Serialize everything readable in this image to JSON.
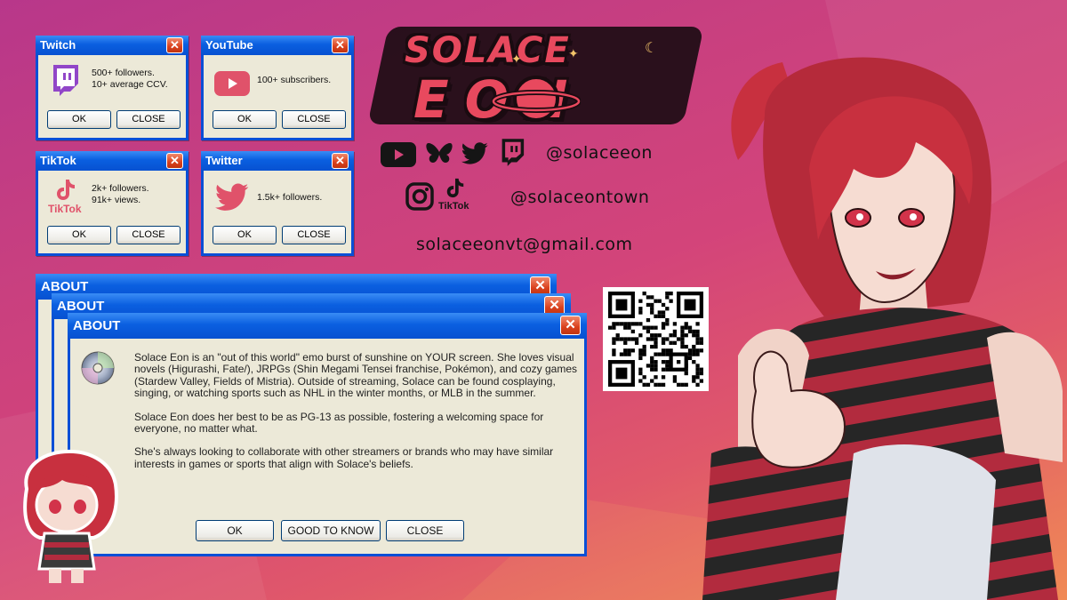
{
  "logo": {
    "line1": "SOLACE",
    "line2": "EON"
  },
  "mini_windows": [
    {
      "title": "Twitch",
      "text": "500+ followers.\n10+ average CCV.",
      "ok": "OK",
      "close": "CLOSE",
      "icon": "twitch-icon"
    },
    {
      "title": "YouTube",
      "text": "100+ subscribers.",
      "ok": "OK",
      "close": "CLOSE",
      "icon": "youtube-icon"
    },
    {
      "title": "TikTok",
      "text": "2k+ followers.\n91k+ views.",
      "ok": "OK",
      "close": "CLOSE",
      "icon": "tiktok-icon",
      "icon_label": "TikTok"
    },
    {
      "title": "Twitter",
      "text": "1.5k+ followers.",
      "ok": "OK",
      "close": "CLOSE",
      "icon": "twitter-bird-icon"
    }
  ],
  "socials": {
    "handle1": "@solaceeon",
    "handle2": "@solaceontown",
    "tiktok_label": "TikTok",
    "email": "solaceeonvt@gmail.com"
  },
  "about": {
    "title": "ABOUT",
    "paragraphs": [
      "Solace Eon is an \"out of this world\" emo burst of sunshine on YOUR screen. She loves visual novels (Higurashi, Fate/), JRPGs (Shin Megami Tensei franchise, Pokémon), and cozy games (Stardew Valley, Fields of Mistria). Outside of streaming, Solace can be found cosplaying, singing, or watching sports such as NHL in the winter months, or MLB in the summer.",
      "Solace Eon does her best to be as PG-13 as possible, fostering a welcoming space for everyone, no matter what.",
      "She's always looking to collaborate with other streamers or brands who may have similar interests in games or sports that align with Solace's beliefs."
    ],
    "buttons": {
      "ok": "OK",
      "good": "GOOD TO KNOW",
      "close": "CLOSE"
    }
  },
  "colors": {
    "accent_red": "#e8495e",
    "window_blue": "#0a4fd6",
    "window_face": "#ece9d8"
  }
}
